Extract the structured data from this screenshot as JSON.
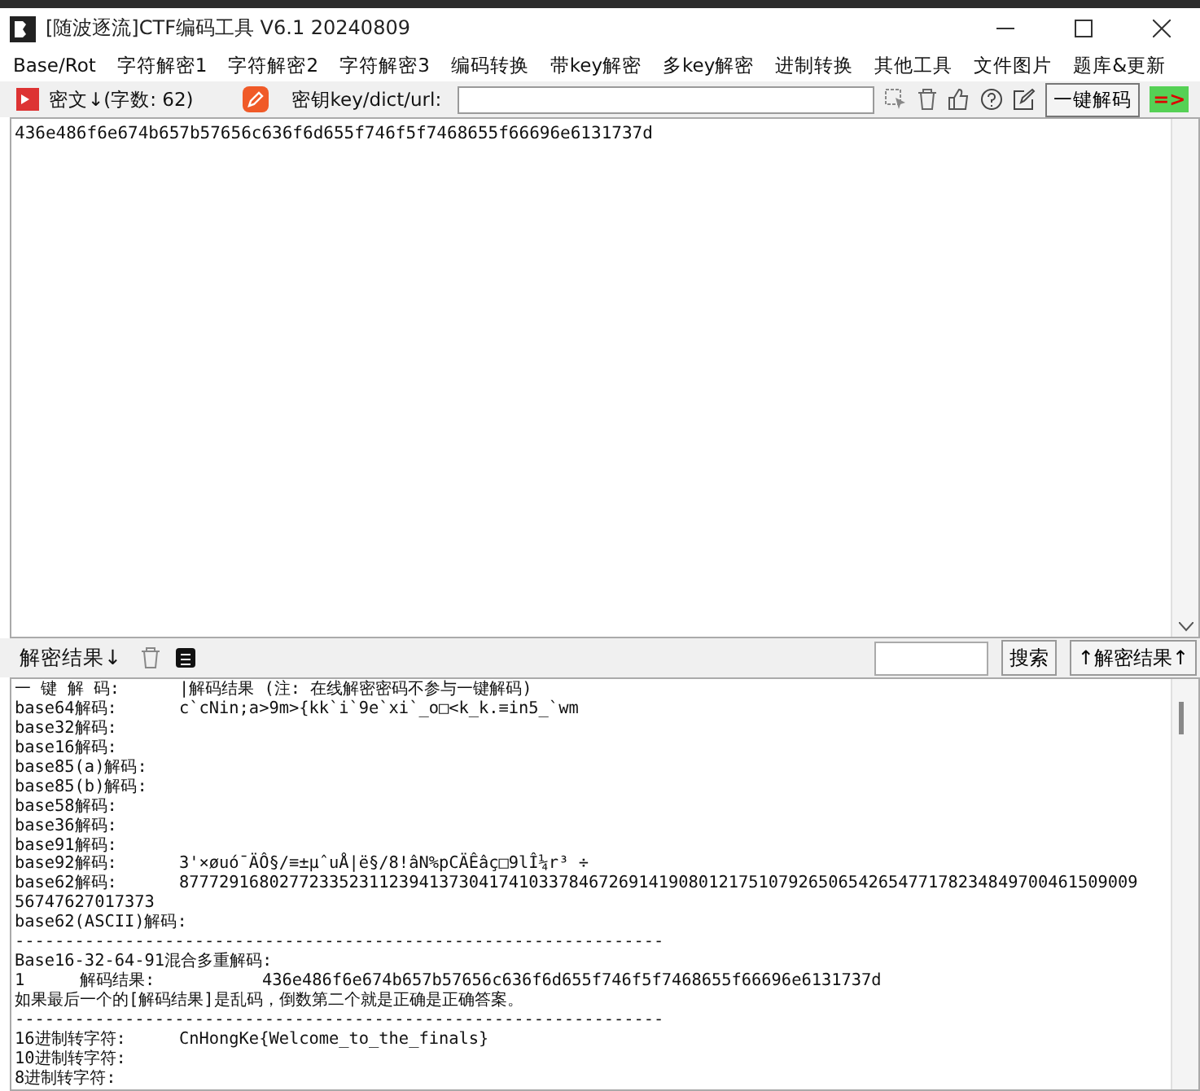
{
  "window": {
    "title": "[随波逐流]CTF编码工具 V6.1 20240809"
  },
  "menu": [
    "Base/Rot",
    "字符解密1",
    "字符解密2",
    "字符解密3",
    "编码转换",
    "带key解密",
    "多key解密",
    "进制转换",
    "其他工具",
    "文件图片",
    "题库&更新"
  ],
  "toolbar": {
    "cipher_label": "密文↓(字数: 62)",
    "key_label": "密钥key/dict/url:",
    "decode_button": "一键解码",
    "arrow": "=>"
  },
  "input": {
    "value": "436e486f6e674b657b57656c636f6d655f746f5f7468655f66696e6131737d"
  },
  "results_bar": {
    "label": "解密结果↓",
    "search_button": "搜索",
    "up_button": "↑解密结果↑"
  },
  "results": [
    {
      "kind": "row",
      "label": "一 键 解 码:",
      "value": "|解码结果 (注: 在线解密密码不参与一键解码)"
    },
    {
      "kind": "row",
      "label": "base64解码:",
      "value": "c`cNin;a>9m>{kk`i`9e`xi`_o□<k_k.≡in5_`wm"
    },
    {
      "kind": "row",
      "label": "base32解码:"
    },
    {
      "kind": "row",
      "label": "base16解码:"
    },
    {
      "kind": "row",
      "label": "base85(a)解码:"
    },
    {
      "kind": "row",
      "label": "base85(b)解码:"
    },
    {
      "kind": "row",
      "label": "base58解码:"
    },
    {
      "kind": "row",
      "label": "base36解码:"
    },
    {
      "kind": "row",
      "label": "base91解码:"
    },
    {
      "kind": "row",
      "label": "base92解码:",
      "value": "3'×øuó¯ÄÔ§/≡±μˆuÅ|ë§/8!âN%pCÄÊâç□9lÎ¼r³ ÷"
    },
    {
      "kind": "row",
      "label": "base62解码:",
      "value": "877729168027723352311239413730417410337846726914190801217510792650654265477178234849700461509009"
    },
    {
      "kind": "line",
      "text": "56747627017373"
    },
    {
      "kind": "row",
      "label": "base62(ASCII)解码:"
    },
    {
      "kind": "line",
      "text": "-----------------------------------------------------------------"
    },
    {
      "kind": "line",
      "text": "Base16-32-64-91混合多重解码:"
    },
    {
      "kind": "triple",
      "label": "1",
      "middle": "解码结果:",
      "value": "436e486f6e674b657b57656c636f6d655f746f5f7468655f66696e6131737d"
    },
    {
      "kind": "line",
      "text": "如果最后一个的[解码结果]是乱码，倒数第二个就是正确是正确答案。"
    },
    {
      "kind": "line",
      "text": "-----------------------------------------------------------------"
    },
    {
      "kind": "row",
      "label": "16进制转字符:",
      "value": "CnHongKe{Welcome_to_the_finals}"
    },
    {
      "kind": "row",
      "label": "10进制转字符:"
    },
    {
      "kind": "row",
      "label": "8进制转字符:"
    }
  ]
}
